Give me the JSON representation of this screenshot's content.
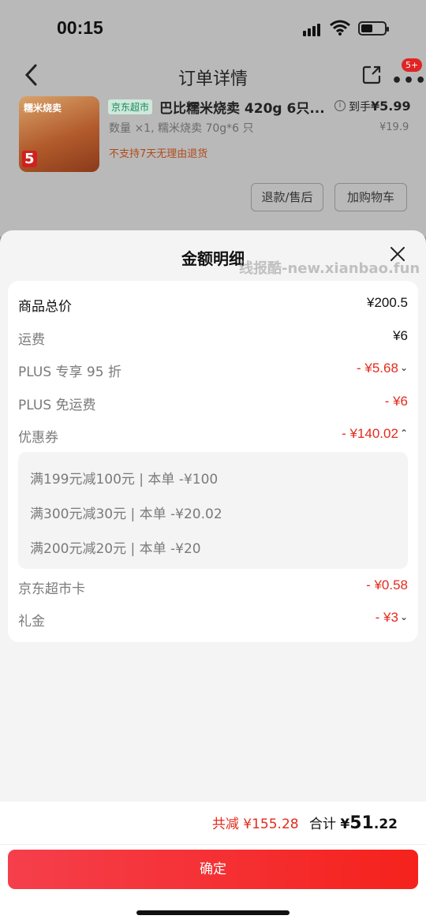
{
  "status_bar": {
    "time": "00:15"
  },
  "nav": {
    "title": "订单详情",
    "badge": "5+"
  },
  "product": {
    "thumb_title": "糯米烧卖",
    "thumb_tag": "5",
    "store_tag": "京东超市",
    "name": "巴比糯米烧卖 420g 6只...",
    "daoshou_label": "到手",
    "daoshou_price": "¥5.99",
    "spec": "数量 ×1, 糯米烧卖 70g*6 只",
    "original_price": "¥19.9",
    "return_note": "不支持7天无理由退货",
    "btn_refund": "退款/售后",
    "btn_cart": "加购物车"
  },
  "sheet": {
    "title": "金额明细",
    "watermark": "线报酷-new.xianbao.fun",
    "rows": [
      {
        "label": "商品总价",
        "value": "¥200.5"
      },
      {
        "label": "运费",
        "value": "¥6"
      },
      {
        "label": "PLUS 专享 95 折",
        "value": "- ¥5.68"
      },
      {
        "label": "PLUS 免运费",
        "value": "- ¥6"
      },
      {
        "label": "优惠券",
        "value": "- ¥140.02"
      },
      {
        "label": "京东超市卡",
        "value": "- ¥0.58"
      },
      {
        "label": "礼金",
        "value": "- ¥3"
      }
    ],
    "coupons": [
      "满199元减100元 | 本单 -¥100",
      "满300元减30元 | 本单 -¥20.02",
      "满200元减20元 | 本单 -¥20"
    ]
  },
  "footer": {
    "saved_label": "共减",
    "saved_value": "¥155.28",
    "sum_label": "合计",
    "sum_currency": "¥",
    "sum_int": "51",
    "sum_dec": ".22",
    "confirm": "确定"
  },
  "colors": {
    "accent_red": "#e42a1c",
    "button_red": "#f5221c",
    "store_green": "#1a8a5a"
  }
}
